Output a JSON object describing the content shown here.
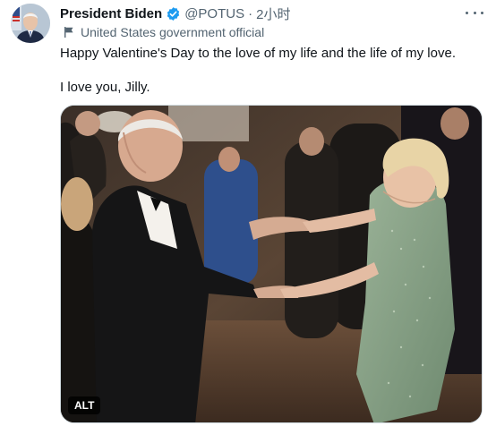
{
  "author": {
    "display_name": "President Biden",
    "handle": "@POTUS",
    "separator": "·",
    "time": "2小时",
    "affiliation": "United States government official"
  },
  "tweet": {
    "line1": "Happy Valentine's Day to the love of my life and the life of my love.",
    "line2": "I love you, Jilly."
  },
  "media": {
    "alt_badge": "ALT",
    "description": "photo"
  },
  "icons": {
    "verified": "verified-badge-icon",
    "affiliation": "flag-icon",
    "more": "more-horizontal-icon"
  },
  "colors": {
    "text_primary": "#0f1419",
    "text_secondary": "#536471",
    "verified_blue": "#1d9bf0"
  }
}
